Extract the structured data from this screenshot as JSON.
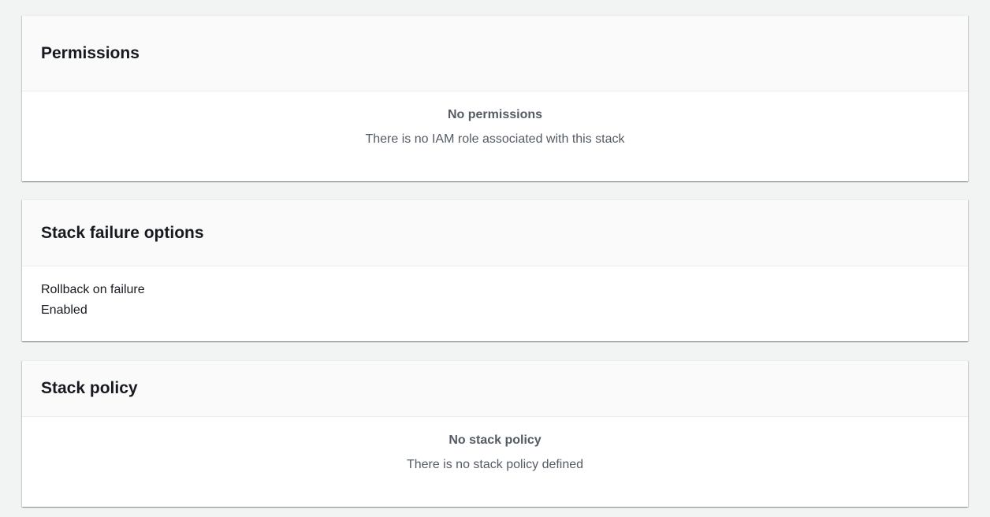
{
  "permissions": {
    "title": "Permissions",
    "empty_title": "No permissions",
    "empty_description": "There is no IAM role associated with this stack"
  },
  "failure_options": {
    "title": "Stack failure options",
    "rollback_label": "Rollback on failure",
    "rollback_value": "Enabled"
  },
  "stack_policy": {
    "title": "Stack policy",
    "empty_title": "No stack policy",
    "empty_description": "There is no stack policy defined"
  }
}
